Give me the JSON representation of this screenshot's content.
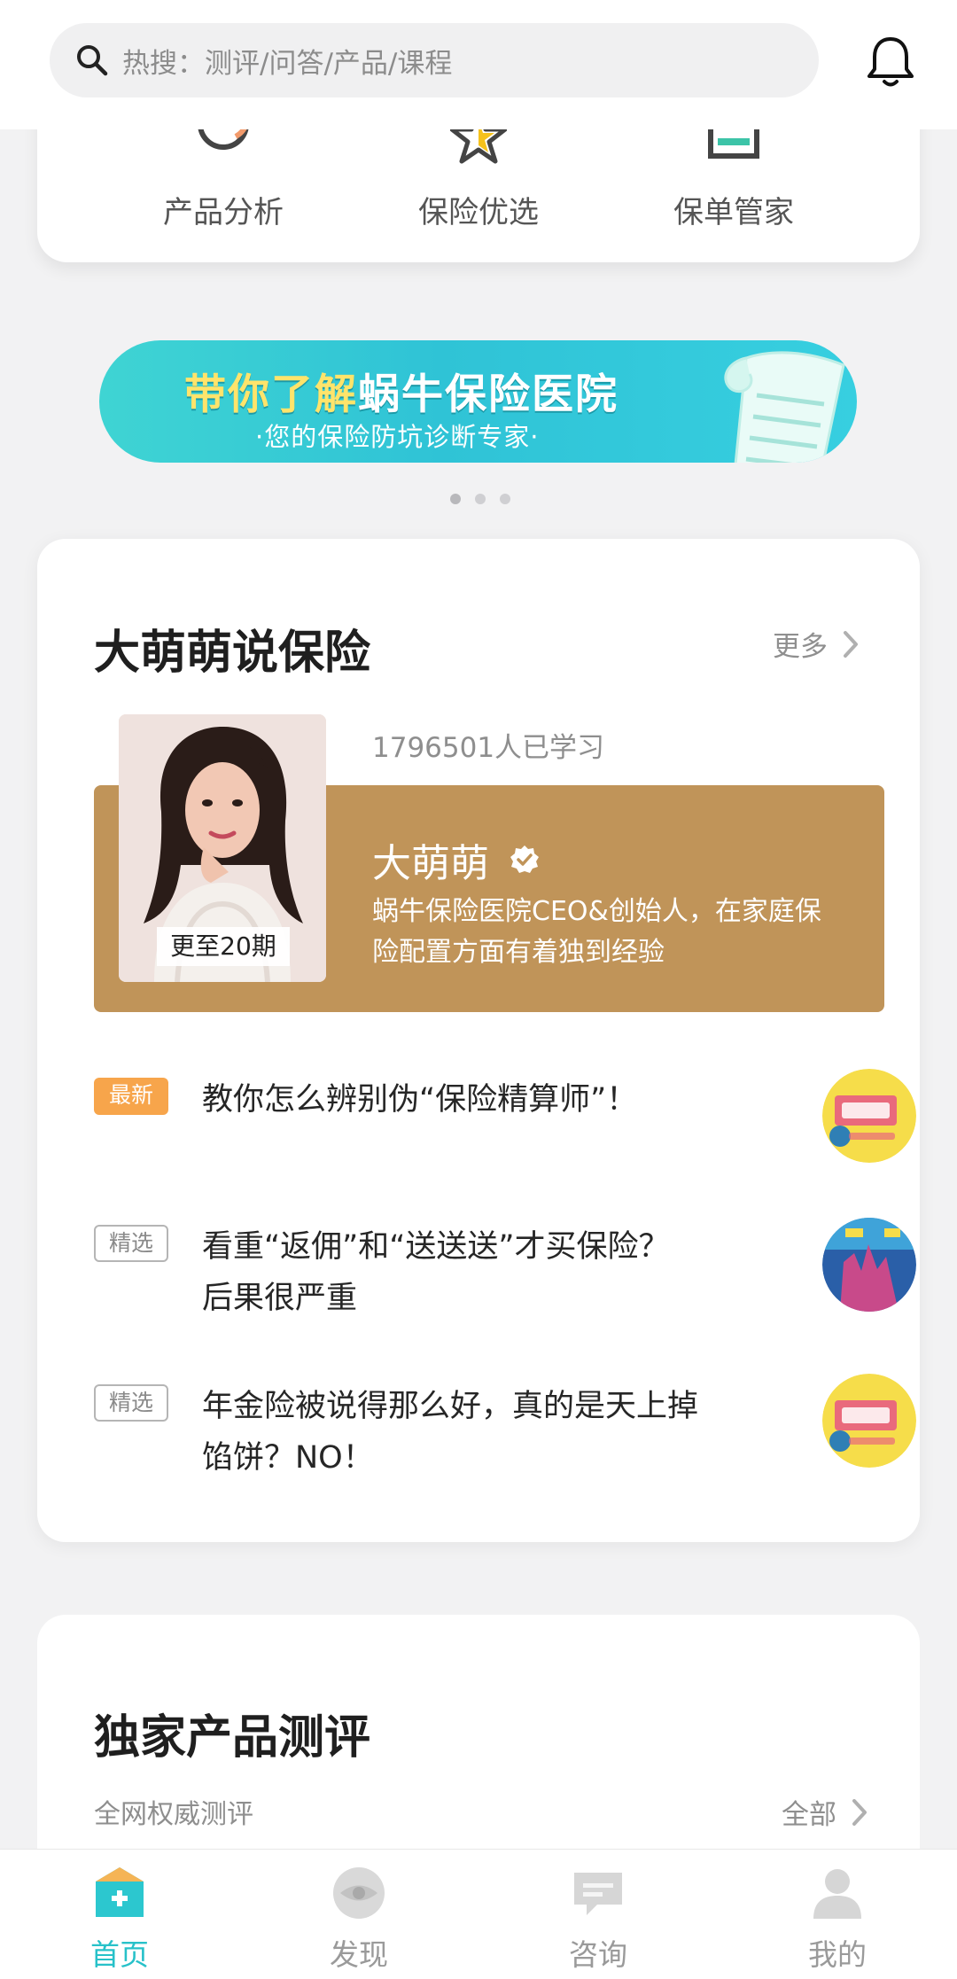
{
  "search": {
    "placeholder": "热搜：测评/问答/产品/课程"
  },
  "quick_menu": [
    {
      "label": "产品分析",
      "icon": "gauge-icon"
    },
    {
      "label": "保险优选",
      "icon": "star-icon"
    },
    {
      "label": "保单管家",
      "icon": "document-icon"
    }
  ],
  "banner": {
    "title_part1": "带你了解",
    "title_part2": "蜗牛保险医院",
    "subtitle": "·您的保险防坑诊断专家·",
    "page_count": 3,
    "active_index": 0
  },
  "featured": {
    "title": "大萌萌说保险",
    "more_label": "更多",
    "learners": "1796501人已学习",
    "episode_badge": "更至20期",
    "host_name": "大萌萌",
    "host_desc": "蜗牛保险医院CEO&创始人，在家庭保险配置方面有着独到经验",
    "articles": [
      {
        "tag": "最新",
        "tag_type": "new",
        "title": "教你怎么辨别伪“保险精算师”！"
      },
      {
        "tag": "精选",
        "tag_type": "pick",
        "title": "看重“返佣”和“送送送”才买保险？后果很严重"
      },
      {
        "tag": "精选",
        "tag_type": "pick",
        "title": "年金险被说得那么好，真的是天上掉馅饼？NO！"
      }
    ]
  },
  "review": {
    "title": "独家产品测评",
    "subtitle": "全网权威测评",
    "all_label": "全部"
  },
  "bottom_nav": [
    {
      "label": "首页",
      "icon": "home-icon",
      "active": true
    },
    {
      "label": "发现",
      "icon": "eye-icon",
      "active": false
    },
    {
      "label": "咨询",
      "icon": "chat-icon",
      "active": false
    },
    {
      "label": "我的",
      "icon": "user-icon",
      "active": false
    }
  ],
  "colors": {
    "accent": "#27c1c9",
    "host_box": "#c09459",
    "new_tag": "#f7a54b",
    "banner_title": "#ffe46b"
  }
}
